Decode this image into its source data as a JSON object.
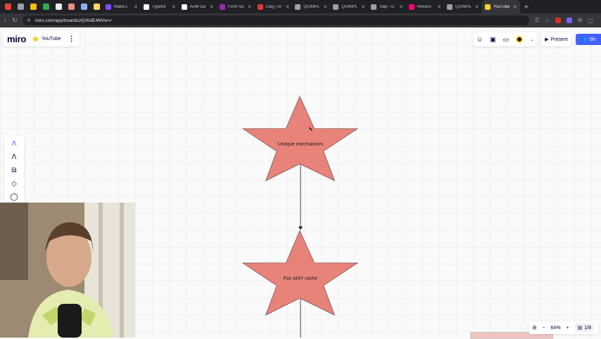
{
  "browser": {
    "tabs": [
      {
        "title": "Make.c",
        "color": "#7c4dff"
      },
      {
        "title": "Typefor",
        "color": "#ffffff"
      },
      {
        "title": "AAM Da",
        "color": "#ffffff"
      },
      {
        "title": "Form Su",
        "color": "#9c27b0"
      },
      {
        "title": "Clay | Ar",
        "color": "#e53935"
      },
      {
        "title": "QUIMPL",
        "color": "#9aa0a6"
      },
      {
        "title": "QUIMPL",
        "color": "#9aa0a6"
      },
      {
        "title": "Vapi - D",
        "color": "#9aa0a6"
      },
      {
        "title": "Receivi",
        "color": "#ff0080"
      },
      {
        "title": "QUIMPL",
        "color": "#9aa0a6"
      },
      {
        "title": "YouTube",
        "color": "#ffd02f"
      }
    ],
    "url": "miro.com/app/board/uXjVKdE4NVw=/"
  },
  "miro": {
    "logo": "miro",
    "board_name": "YouTube",
    "present_label": "Present",
    "share_label": "Sh",
    "zoom": "64%",
    "page": "1/8"
  },
  "diagram": {
    "star1_label": "Unique mechanism",
    "star2_label": "For ANY niche",
    "star_fill": "#e8837a"
  }
}
